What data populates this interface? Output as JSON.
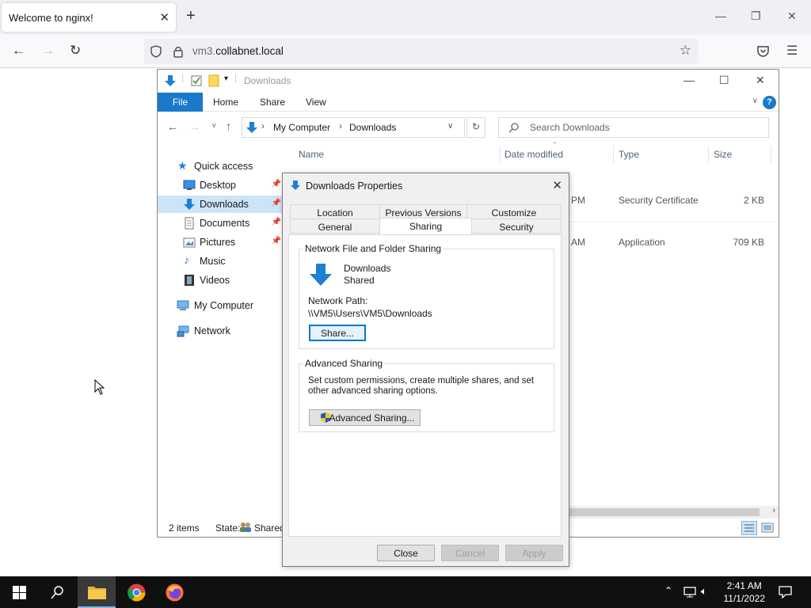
{
  "browser": {
    "tab_title": "Welcome to nginx!",
    "url_host_dim": "vm3.",
    "url_host": "collabnet.local"
  },
  "explorer": {
    "title": "Downloads",
    "ribbon": {
      "file": "File",
      "tabs": [
        "Home",
        "Share",
        "View"
      ]
    },
    "breadcrumb": [
      "My Computer",
      "Downloads"
    ],
    "search_placeholder": "Search Downloads",
    "nav": [
      {
        "label": "Quick access",
        "icon": "star-icon"
      },
      {
        "label": "Desktop",
        "icon": "desktop-icon",
        "pinned": true
      },
      {
        "label": "Downloads",
        "icon": "download-arrow-icon",
        "pinned": true,
        "selected": true
      },
      {
        "label": "Documents",
        "icon": "document-icon",
        "pinned": true
      },
      {
        "label": "Pictures",
        "icon": "picture-icon",
        "pinned": true
      },
      {
        "label": "Music",
        "icon": "music-icon"
      },
      {
        "label": "Videos",
        "icon": "video-icon"
      },
      {
        "label": "My Computer",
        "icon": "computer-icon"
      },
      {
        "label": "Network",
        "icon": "network-icon"
      }
    ],
    "columns": {
      "name": "Name",
      "date": "Date modified",
      "type": "Type",
      "size": "Size"
    },
    "files": [
      {
        "date": "PM",
        "type": "Security Certificate",
        "size": "2 KB"
      },
      {
        "date": "AM",
        "type": "Application",
        "size": "709 KB"
      }
    ],
    "status": {
      "items": "2 items",
      "state_label": "State:",
      "state_value": "Shared"
    }
  },
  "dialog": {
    "title": "Downloads Properties",
    "tabs_row1": [
      "Location",
      "Previous Versions",
      "Customize"
    ],
    "tabs_row2": [
      "General",
      "Sharing",
      "Security"
    ],
    "network_group": {
      "title": "Network File and Folder Sharing",
      "folder_name": "Downloads",
      "folder_state": "Shared",
      "path_label": "Network Path:",
      "path_value": "\\\\VM5\\Users\\VM5\\Downloads",
      "share_button": "Share..."
    },
    "advanced_group": {
      "title": "Advanced Sharing",
      "description": "Set custom permissions, create multiple shares, and set other advanced sharing options.",
      "button": "Advanced Sharing..."
    },
    "buttons": {
      "close": "Close",
      "cancel": "Cancel",
      "apply": "Apply"
    }
  },
  "taskbar": {
    "time": "2:41 AM",
    "date": "11/1/2022"
  },
  "colors": {
    "accent": "#1979ca",
    "selection": "#cce4f7",
    "taskbar": "#101010"
  }
}
